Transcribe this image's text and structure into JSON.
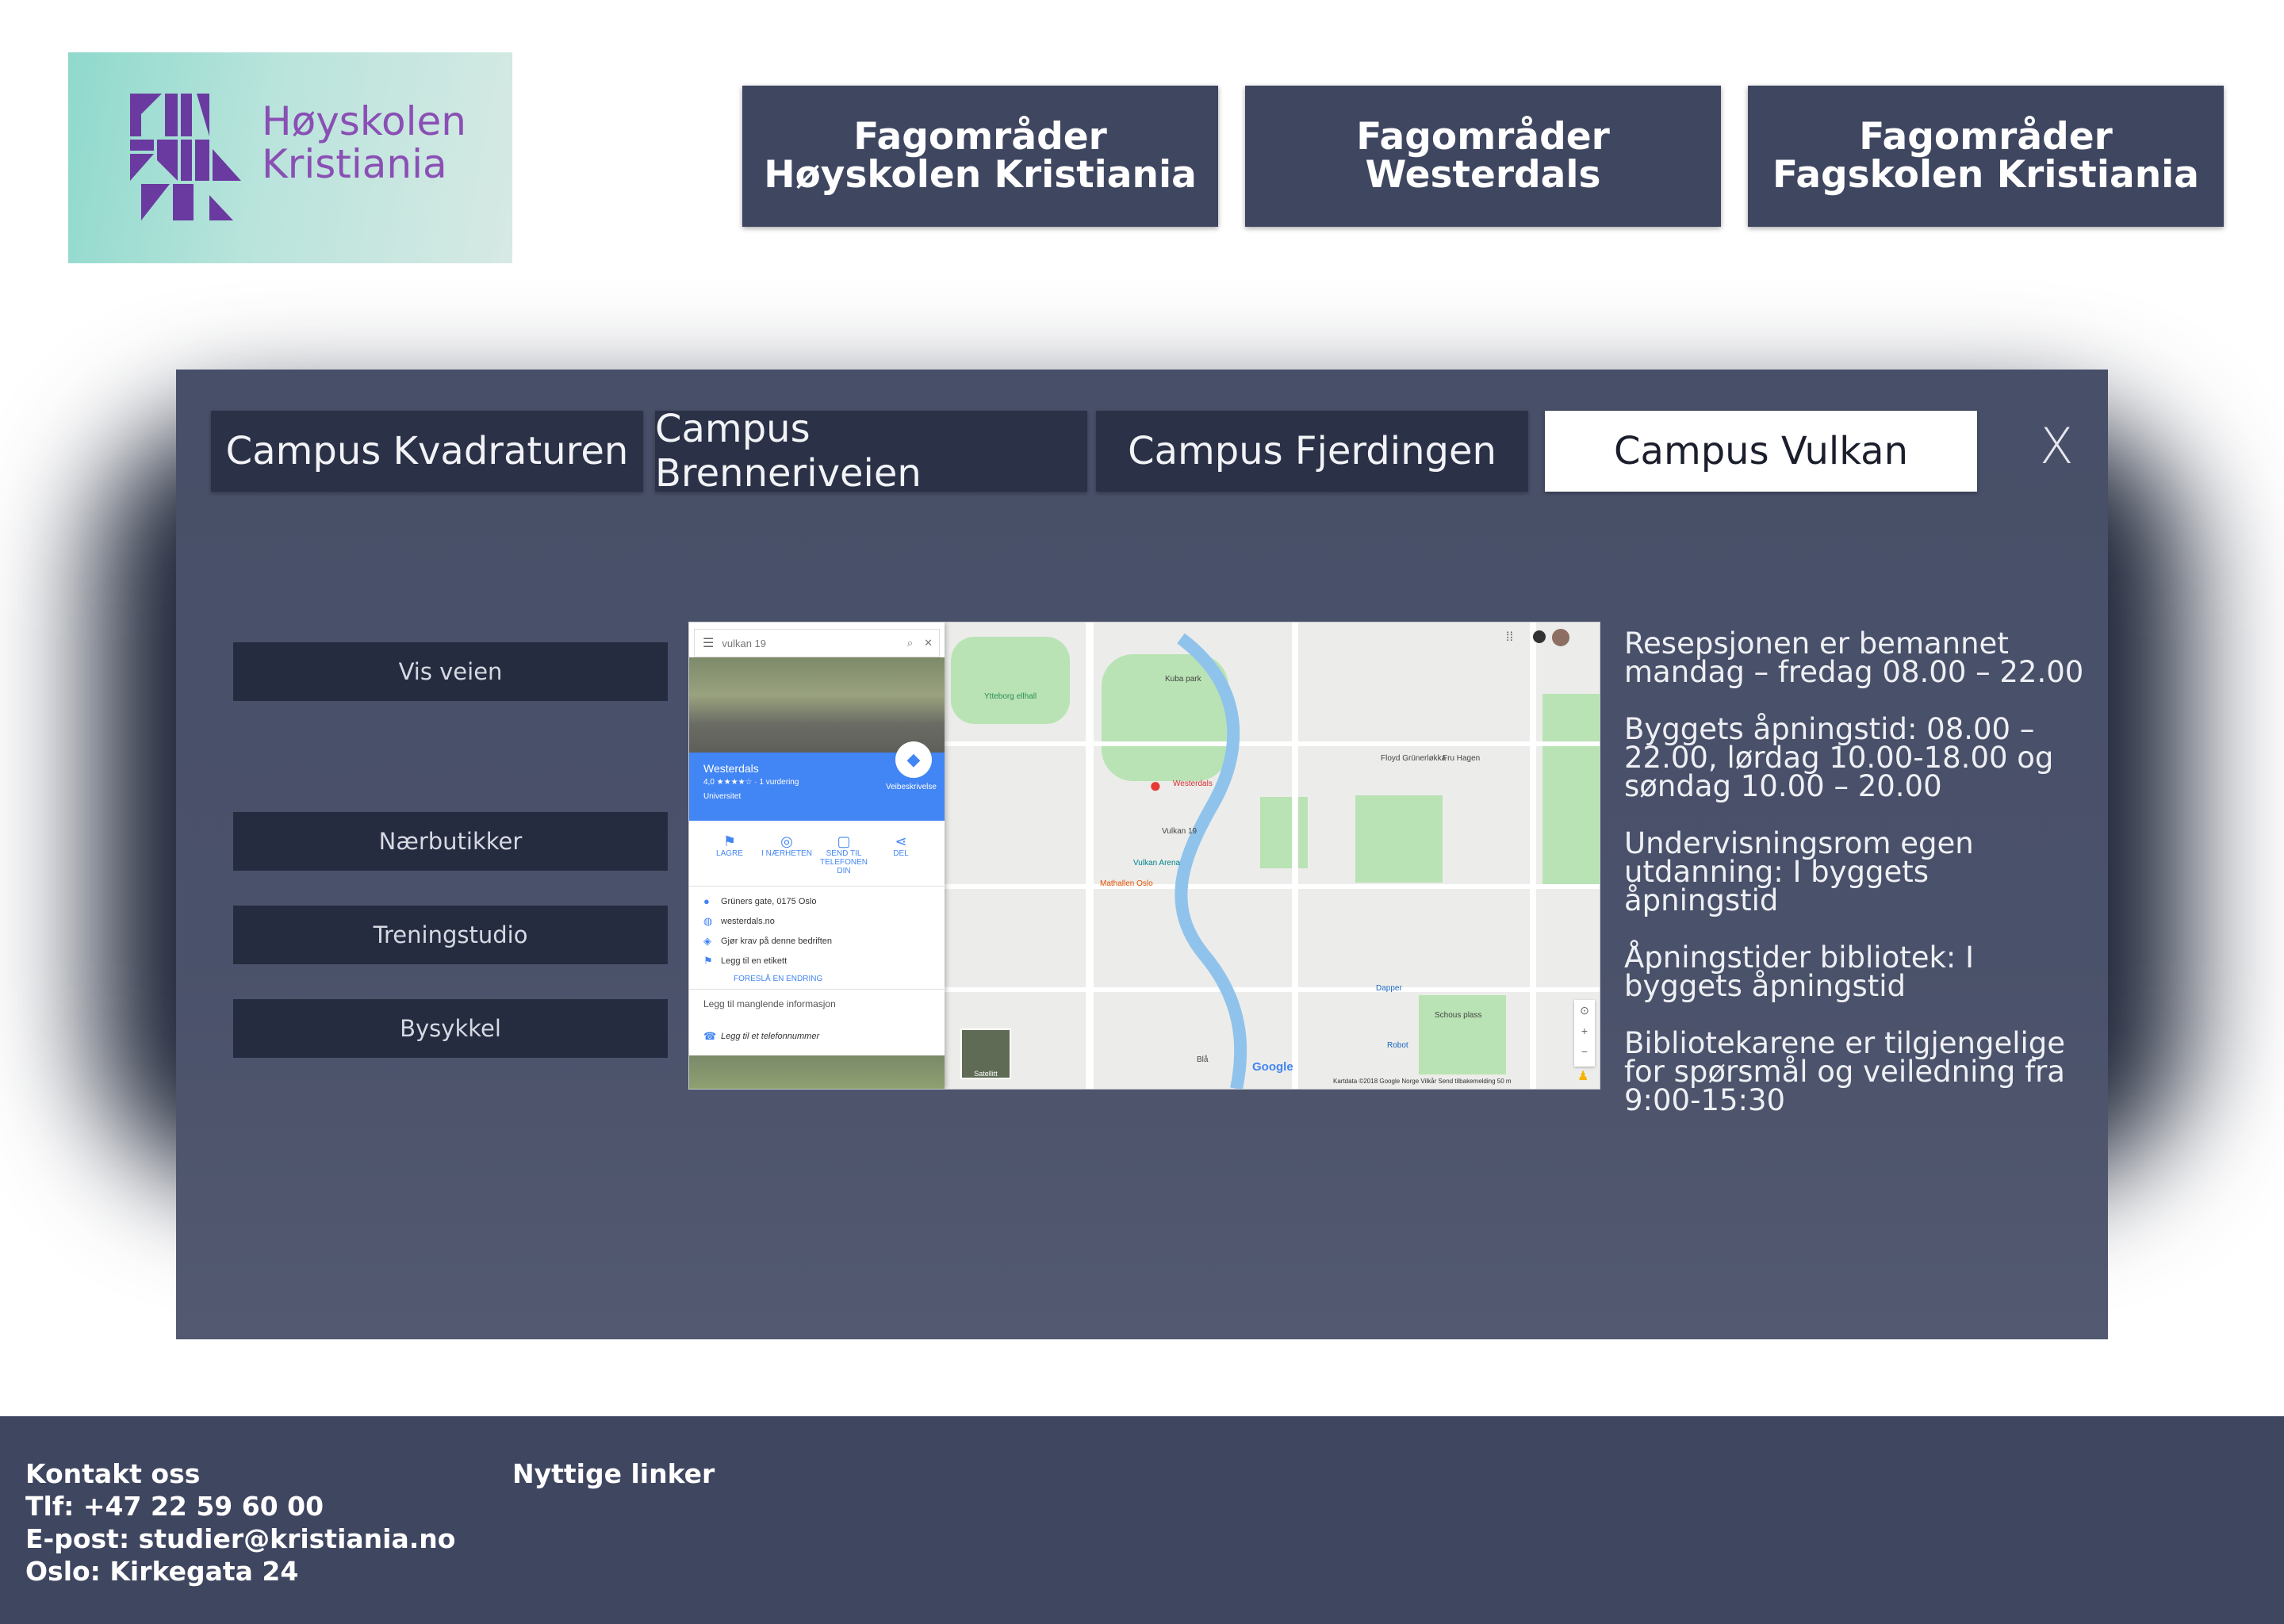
{
  "logo": {
    "line1": "Høyskolen",
    "line2": "Kristiania"
  },
  "nav": [
    {
      "line1": "Fagområder",
      "line2": "Høyskolen Kristiania"
    },
    {
      "line1": "Fagområder",
      "line2": "Westerdals"
    },
    {
      "line1": "Fagområder",
      "line2": "Fagskolen Kristiania"
    }
  ],
  "tabs": [
    {
      "label": "Campus Kvadraturen",
      "active": false
    },
    {
      "label": "Campus Brenneriveien",
      "active": false
    },
    {
      "label": "Campus Fjerdingen",
      "active": false
    },
    {
      "label": "Campus Vulkan",
      "active": true
    }
  ],
  "close_label": "X",
  "side_buttons": [
    "Vis veien",
    "Nærbutikker",
    "Treningstudio",
    "Bysykkel"
  ],
  "info": [
    "Resepsjonen er bemannet mandag – fredag 08.00 – 22.00",
    "Byggets åpningstid: 08.00 – 22.00, lørdag 10.00-18.00 og søndag 10.00 – 20.00",
    "Undervisningsrom egen utdanning: I byggets åpningstid",
    "Åpningstider bibliotek: I byggets åpningstid",
    "Bibliotekarene er tilgjengelige for spørsmål og veiledning fra 9:00-15:30"
  ],
  "map": {
    "search_value": "vulkan 19",
    "place_name": "Westerdals",
    "rating": "4,0 ★★★★☆ · 1 vurdering",
    "category": "Universitet",
    "directions_label": "Veibeskrivelse",
    "actions": [
      "LAGRE",
      "I NÆRHETEN",
      "SEND TIL TELEFONEN DIN",
      "DEL"
    ],
    "details": [
      "Grüners gate, 0175 Oslo",
      "westerdals.no",
      "Gjør krav på denne bedriften",
      "Legg til en etikett"
    ],
    "suggest_edit": "FORESLÅ EN ENDRING",
    "missing_info": "Legg til manglende informasjon",
    "add_phone": "Legg til et telefonnummer",
    "satellite": "Satellitt",
    "google": "Google",
    "attribution": "Kartdata ©2018 Google   Norge   Vilkår   Send tilbakemelding   50 m",
    "places": [
      "Kuba park",
      "Ytteborg ellhall",
      "Westerdals",
      "Vulkan 19",
      "Vulkan Arena",
      "Mathallen Oslo",
      "Floyd Grünerløkka",
      "Fru Hagen",
      "Dapper",
      "Robot",
      "Schous plass",
      "Blå"
    ],
    "pin_label": "Westerdals"
  },
  "footer": {
    "contact_title": "Kontakt oss",
    "phone": "Tlf: +47 22 59 60 00",
    "email": "E-post: studier@kristiania.no",
    "address": "Oslo: Kirkegata 24",
    "links_title": "Nyttige linker"
  }
}
